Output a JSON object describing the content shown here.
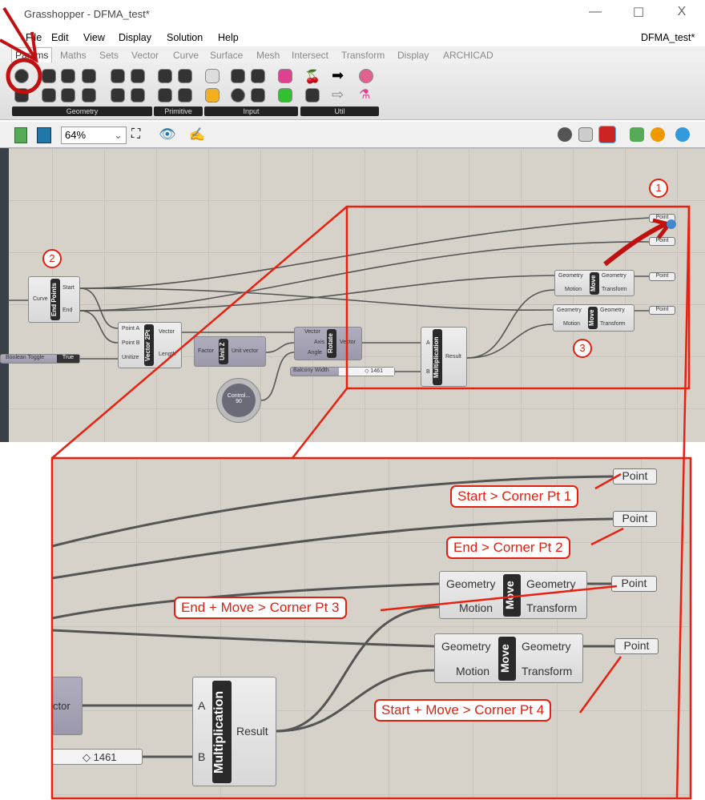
{
  "window": {
    "title": "Grasshopper - DFMA_test*",
    "doc_name": "DFMA_test*",
    "min": "—",
    "max": "☐",
    "close": "X"
  },
  "menu": [
    "File",
    "Edit",
    "View",
    "Display",
    "Solution",
    "Help"
  ],
  "tabs": [
    "Params",
    "Maths",
    "Sets",
    "Vector",
    "Curve",
    "Surface",
    "Mesh",
    "Intersect",
    "Transform",
    "Display",
    "ARCHICAD"
  ],
  "ribbon_groups": [
    "Geometry",
    "Primitive",
    "Input",
    "Util"
  ],
  "toolbar": {
    "zoom": "64%"
  },
  "accent": "#e02010",
  "callouts": [
    "1",
    "2",
    "3"
  ],
  "nodes": {
    "endpoints": {
      "title": "End Points",
      "in": [
        "Curve"
      ],
      "out": [
        "Start",
        "End"
      ]
    },
    "vector2pt": {
      "title": "Vector 2Pt",
      "in": [
        "Point A",
        "Point B",
        "Unitize"
      ],
      "out": [
        "Vector",
        "Length"
      ]
    },
    "toggle": {
      "label": "Boolean Toggle",
      "value": "True"
    },
    "unitz": {
      "title": "Unit Z",
      "in": [
        "Factor"
      ],
      "out": [
        "Unit vector"
      ]
    },
    "rotate": {
      "title": "Rotate",
      "in": [
        "Vector",
        "Axis",
        "Angle"
      ],
      "out": [
        "Vector"
      ]
    },
    "slider": {
      "label": "Balcony Width",
      "value": "◇ 1461"
    },
    "knob": {
      "label": "Control...",
      "value": "90"
    },
    "mult": {
      "title": "Multiplication",
      "in": [
        "A",
        "B"
      ],
      "out": [
        "Result"
      ]
    },
    "move": {
      "title": "Move",
      "in": [
        "Geometry",
        "Motion"
      ],
      "out": [
        "Geometry",
        "Transform"
      ]
    },
    "point": "Point"
  },
  "zoom": {
    "vector_partial": "ctor",
    "slider_value": "◇ 1461",
    "labels": [
      "Start > Corner Pt 1",
      "End > Corner Pt 2",
      "End + Move  > Corner Pt 3",
      "Start + Move  > Corner Pt 4"
    ]
  }
}
